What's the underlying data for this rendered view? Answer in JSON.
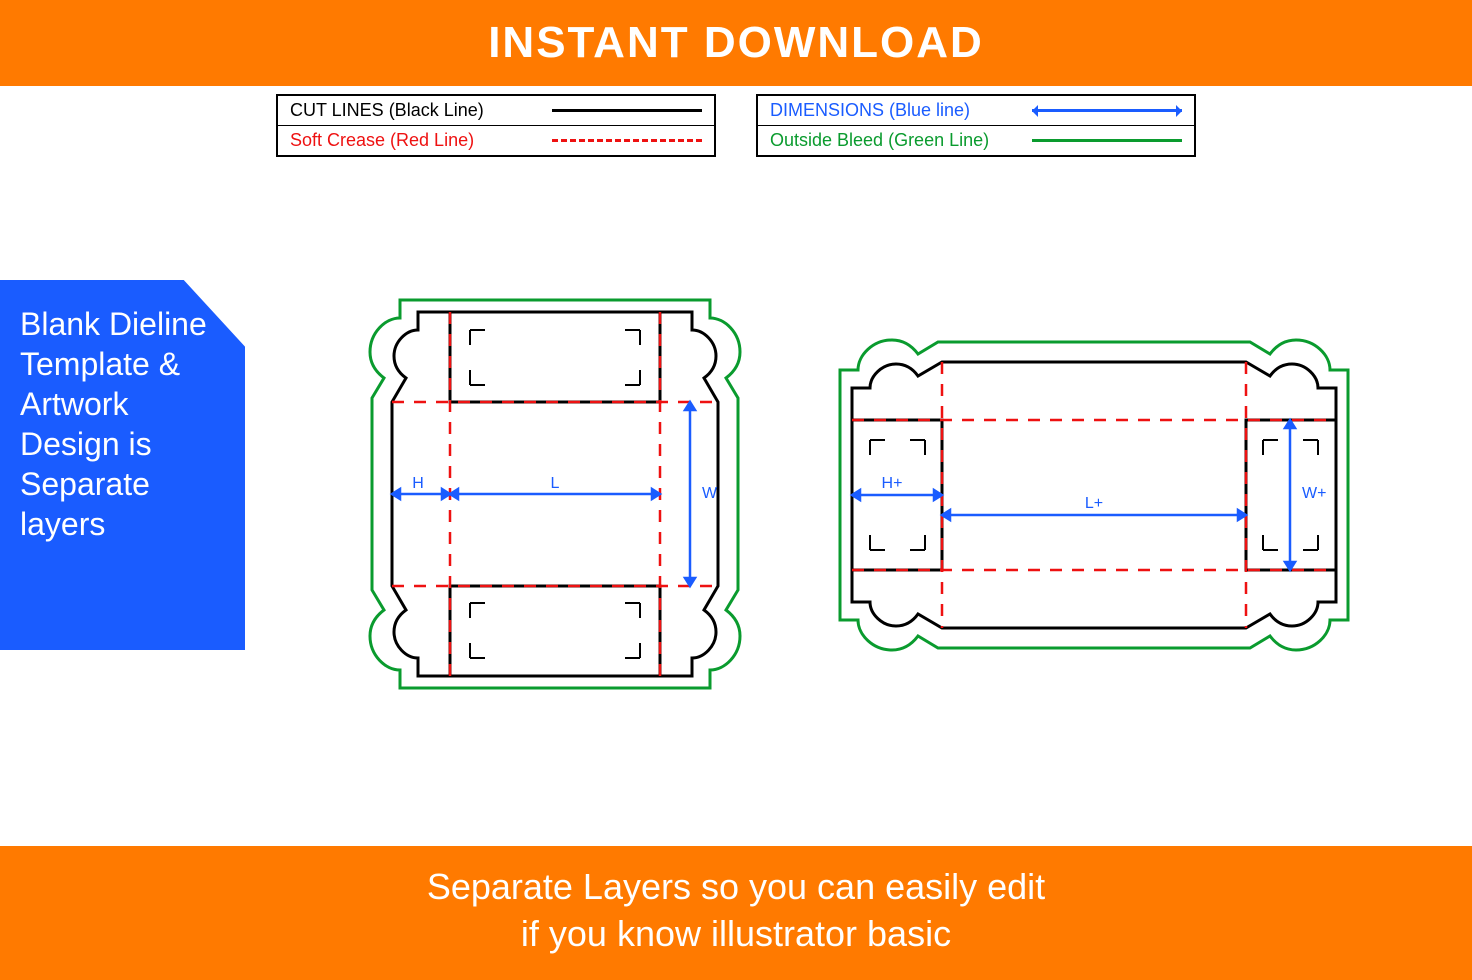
{
  "header": {
    "title": "INSTANT DOWNLOAD"
  },
  "legend": {
    "left": [
      {
        "label": "CUT LINES (Black Line)",
        "color": "black"
      },
      {
        "label": "Soft Crease (Red Line)",
        "color": "red"
      }
    ],
    "right": [
      {
        "label": "DIMENSIONS (Blue line)",
        "color": "blue"
      },
      {
        "label": "Outside Bleed (Green Line)",
        "color": "green"
      }
    ]
  },
  "side_panel": {
    "text": "Blank Dieline Template & Artwork Design is Separate layers"
  },
  "diagrams": {
    "left": {
      "dims": [
        "H",
        "L",
        "W"
      ]
    },
    "right": {
      "dims": [
        "H+",
        "L+",
        "W+"
      ]
    }
  },
  "footer": {
    "line1": "Separate Layers so you can easily edit",
    "line2": "if you know illustrator basic"
  }
}
